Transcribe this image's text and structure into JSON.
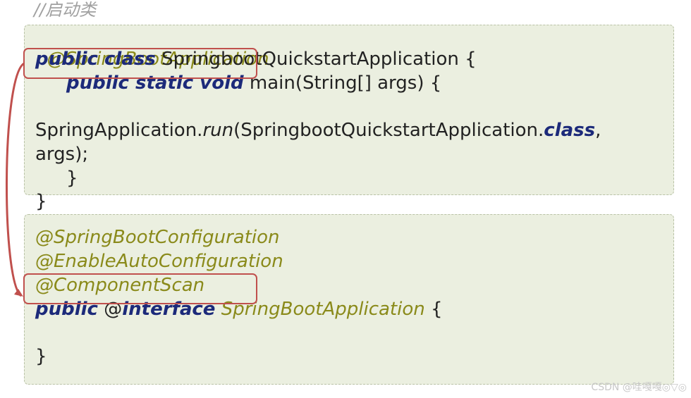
{
  "comment": "//启动类",
  "block1": {
    "annotation": "@SpringBootApplication",
    "line_class_kw": "public class",
    "line_class_name": " SpringbootQuickstartApplication {",
    "line_main_kw": "public static void",
    "line_main_rest": " main(String[] args) {",
    "line_run_pre": "SpringApplication.",
    "line_run_method": "run",
    "line_run_mid": "(SpringbootQuickstartApplication.",
    "line_run_kw": "class",
    "line_run_post": ",",
    "line_args": "args);",
    "close_inner": "}",
    "close_outer": "}"
  },
  "block2": {
    "ann1": "@SpringBootConfiguration",
    "ann2": "@EnableAutoConfiguration",
    "ann3": "@ComponentScan",
    "decl_kw1": "public",
    "decl_at": " @",
    "decl_kw2": "interface",
    "decl_name": " SpringBootApplication",
    "decl_brace": " {",
    "close": "}"
  },
  "colors": {
    "annotation": "#8a8a1a",
    "keyword": "#1c2a7a",
    "panel_bg": "#ebefe0",
    "highlight_box": "#c0504d"
  },
  "watermark": "CSDN @哇嘎嘎◎▽◎"
}
